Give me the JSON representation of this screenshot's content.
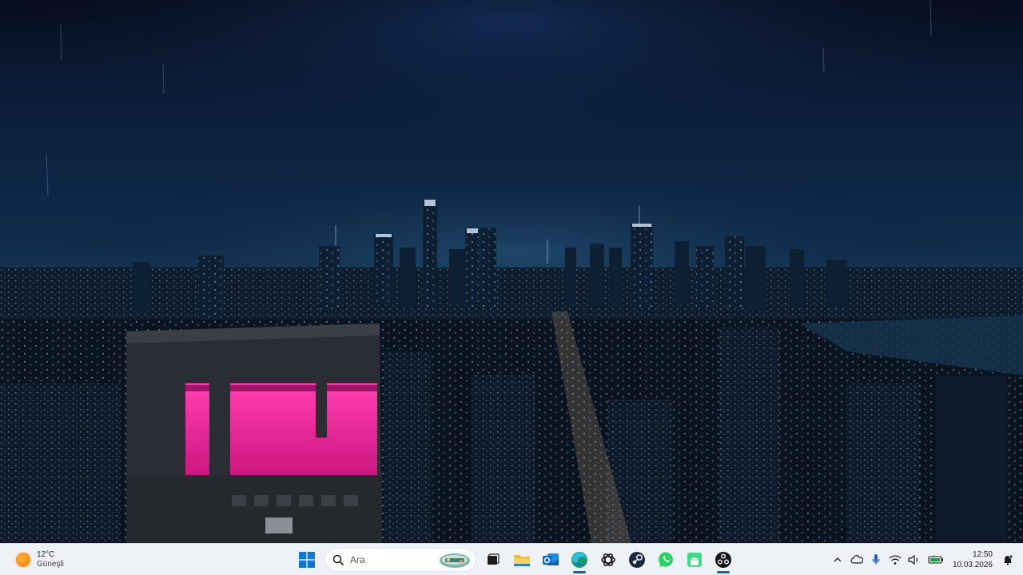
{
  "taskbar": {
    "weather": {
      "temperature": "12°C",
      "condition": "Güneşli",
      "icon": "sun-icon"
    },
    "search": {
      "placeholder": "Ara",
      "icon": "search-icon"
    },
    "pinned_apps": [
      {
        "name": "start",
        "icon": "windows-logo-icon"
      },
      {
        "name": "task-view",
        "icon": "task-view-icon"
      },
      {
        "name": "file-explorer",
        "icon": "folder-icon"
      },
      {
        "name": "outlook",
        "icon": "outlook-icon"
      },
      {
        "name": "edge",
        "icon": "edge-icon"
      },
      {
        "name": "chatgpt",
        "icon": "chatgpt-icon"
      },
      {
        "name": "steam",
        "icon": "steam-icon"
      },
      {
        "name": "whatsapp",
        "icon": "whatsapp-icon"
      },
      {
        "name": "android-app",
        "icon": "android-icon"
      },
      {
        "name": "obs-studio",
        "icon": "obs-icon"
      }
    ],
    "clock": {
      "time": "12:50",
      "date": "10.03.2026"
    },
    "tray_icons": [
      "chevron-up-icon",
      "onedrive-cloud-icon",
      "microphone-icon",
      "wifi-icon",
      "speaker-icon",
      "battery-icon",
      "notification-icon"
    ],
    "colors": {
      "taskbar_bg": "#eef1f6",
      "active_indicator": "#0067c0"
    }
  },
  "wallpaper": {
    "subject": "night-city-skyline-rain"
  }
}
